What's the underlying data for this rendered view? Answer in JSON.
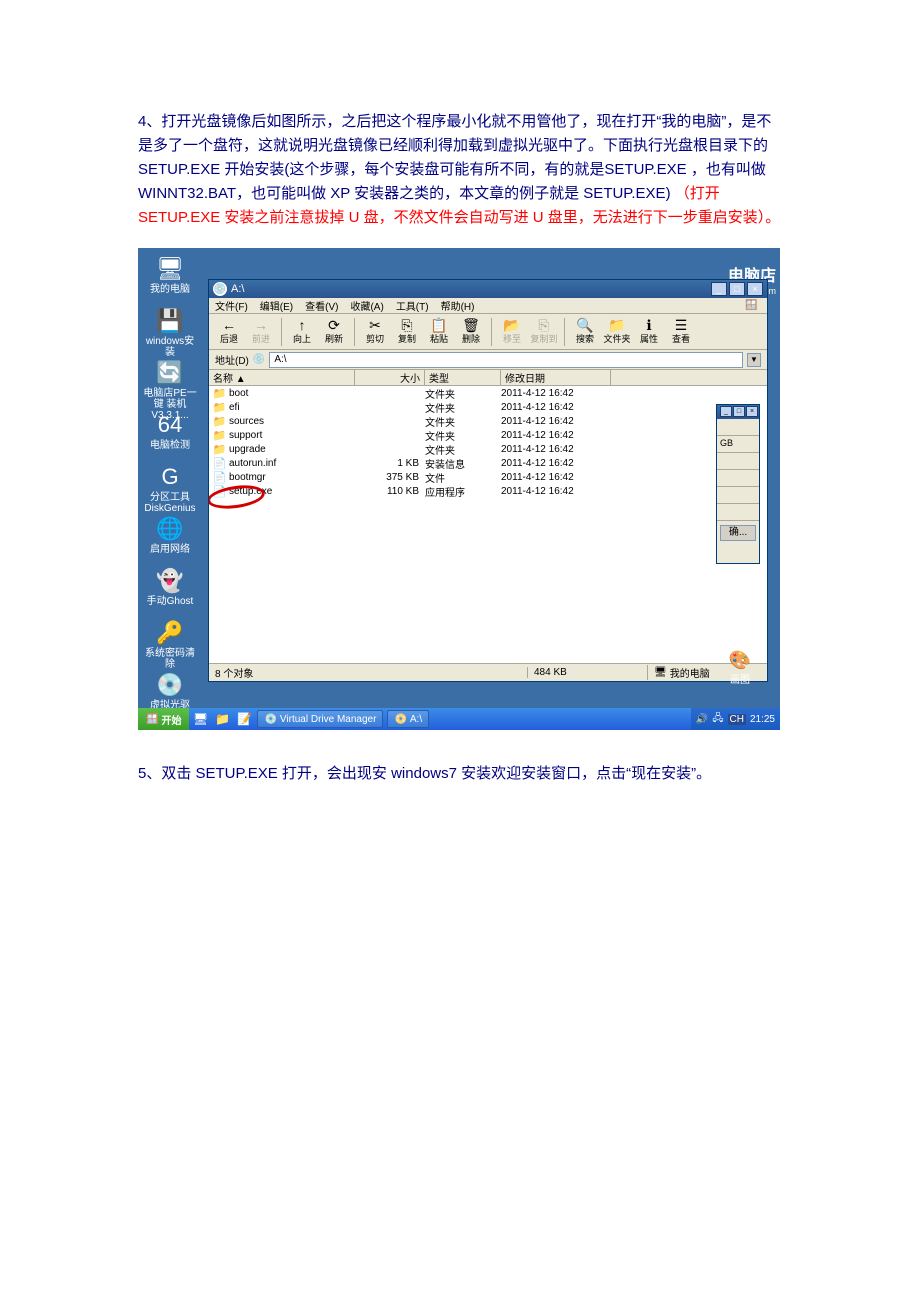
{
  "document": {
    "para1_prefix": "4、打开光盘镜像后如图所示，之后把这个程序最小化就不用管他了，现在打开“我的电脑”，是不是多了一个盘符，这就说明光盘镜像已经顺利得加载到虚拟光驱中了。下面执行光盘根目录下的 SETUP.EXE  开始安装(这个步骤，每个安装盘可能有所不同，有的就是SETUP.EXE ，也有叫做 WINNT32.BAT，也可能叫做 XP 安装器之类的，本文章的例子就是 SETUP.EXE) ",
    "para1_red": "（打开 SETUP.EXE 安装之前注意拔掉 U 盘，不然文件会自动写进 U 盘里，无法进行下一步重启安装）。",
    "para2": "5、双击 SETUP.EXE 打开，会出现安 windows7 安装欢迎安装窗口，点击“现在安装”。"
  },
  "desktop_icons": [
    {
      "label": "我的电脑",
      "glyph": "🖥"
    },
    {
      "label": "windows安装",
      "glyph": "💾"
    },
    {
      "label": "电脑店PE一键 装机 V3.3.1...",
      "glyph": "🔄"
    },
    {
      "label": "电脑检测",
      "glyph": "64"
    },
    {
      "label": "分区工具 DiskGenius",
      "glyph": "G"
    },
    {
      "label": "启用网络",
      "glyph": "🌐"
    },
    {
      "label": "手动Ghost",
      "glyph": "👻"
    },
    {
      "label": "系统密码清除",
      "glyph": "🔑"
    },
    {
      "label": "虚拟光驱",
      "glyph": "💿"
    }
  ],
  "logo": {
    "main": "电脑店",
    "sub": "laoDian.com"
  },
  "explorer": {
    "title": "A:\\",
    "menus": [
      "文件(F)",
      "编辑(E)",
      "查看(V)",
      "收藏(A)",
      "工具(T)",
      "帮助(H)"
    ],
    "toolbar": [
      {
        "label": "后退",
        "glyph": "←",
        "dis": false
      },
      {
        "label": "前进",
        "glyph": "→",
        "dis": true
      },
      {
        "label": "向上",
        "glyph": "↑",
        "dis": false
      },
      {
        "label": "刷新",
        "glyph": "⟳",
        "dis": false
      },
      {
        "label": "剪切",
        "glyph": "✂",
        "dis": false
      },
      {
        "label": "复制",
        "glyph": "⎘",
        "dis": false
      },
      {
        "label": "粘贴",
        "glyph": "📋",
        "dis": false
      },
      {
        "label": "删除",
        "glyph": "🗑",
        "dis": false
      },
      {
        "label": "移至",
        "glyph": "📂",
        "dis": true
      },
      {
        "label": "复制到",
        "glyph": "⎘",
        "dis": true
      },
      {
        "label": "搜索",
        "glyph": "🔍",
        "dis": false
      },
      {
        "label": "文件夹",
        "glyph": "📁",
        "dis": false
      },
      {
        "label": "属性",
        "glyph": "ℹ",
        "dis": false
      },
      {
        "label": "查看",
        "glyph": "☰",
        "dis": false
      }
    ],
    "addr_label": "地址(D)",
    "addr_value": "A:\\",
    "cols": {
      "name": "名称 ▲",
      "size": "大小",
      "type": "类型",
      "date": "修改日期"
    },
    "files": [
      {
        "name": "boot",
        "size": "",
        "type": "文件夹",
        "date": "2011-4-12 16:42",
        "icon": "folder"
      },
      {
        "name": "efi",
        "size": "",
        "type": "文件夹",
        "date": "2011-4-12 16:42",
        "icon": "folder"
      },
      {
        "name": "sources",
        "size": "",
        "type": "文件夹",
        "date": "2011-4-12 16:42",
        "icon": "folder"
      },
      {
        "name": "support",
        "size": "",
        "type": "文件夹",
        "date": "2011-4-12 16:42",
        "icon": "folder"
      },
      {
        "name": "upgrade",
        "size": "",
        "type": "文件夹",
        "date": "2011-4-12 16:42",
        "icon": "folder"
      },
      {
        "name": "autorun.inf",
        "size": "1 KB",
        "type": "安装信息",
        "date": "2011-4-12 16:42",
        "icon": "file"
      },
      {
        "name": "bootmgr",
        "size": "375 KB",
        "type": "文件",
        "date": "2011-4-12 16:42",
        "icon": "file"
      },
      {
        "name": "setup.exe",
        "size": "110 KB",
        "type": "应用程序",
        "date": "2011-4-12 16:42",
        "icon": "file"
      }
    ],
    "status": {
      "left": "8 个对象",
      "mid": "484 KB",
      "right": "我的电脑"
    }
  },
  "smallwin": {
    "unit": "GB",
    "btn": "确..."
  },
  "tray_desktop_icon": {
    "glyph": "🎨",
    "label": "画图"
  },
  "taskbar": {
    "start": "开始",
    "tasks": [
      {
        "label": "Virtual Drive Manager",
        "glyph": "💿"
      },
      {
        "label": "A:\\",
        "glyph": "📀"
      }
    ],
    "tray_time": "21:25",
    "tray_lang": "CH"
  }
}
